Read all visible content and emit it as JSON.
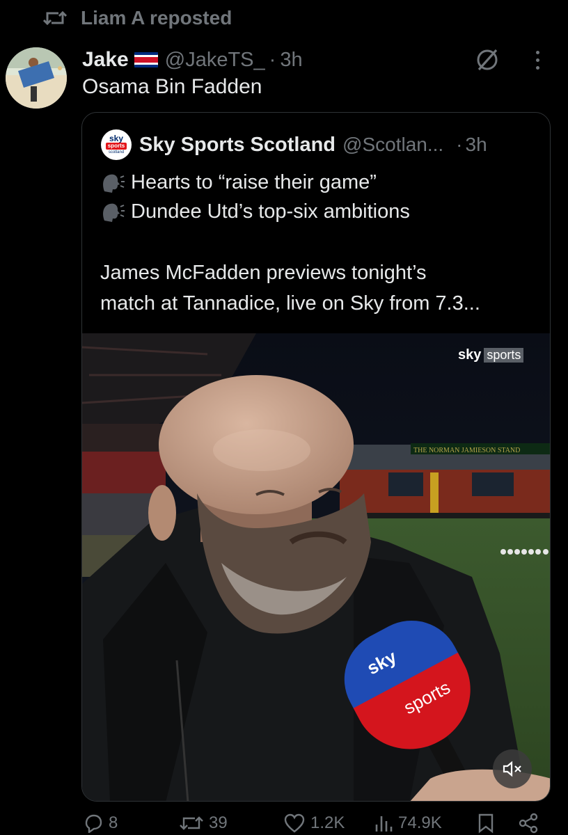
{
  "repost": {
    "icon": "repost-icon",
    "text": "Liam A reposted"
  },
  "tweet": {
    "author_name": "Jake",
    "flag_icon": "costa-rica-flag-icon",
    "handle": "@JakeTS_",
    "separator": "·",
    "time": "3h",
    "text": "Osama Bin Fadden"
  },
  "quote": {
    "logo": {
      "line1": "sky",
      "line2": "sports",
      "line3": "scotland"
    },
    "author_name": "Sky Sports Scotland",
    "handle": "@Scotlan...",
    "separator": "·",
    "time": "3h",
    "line1": "Hearts to “raise their game”",
    "line2": "Dundee Utd’s top-six ambitions",
    "line3": "James McFadden previews tonight’s",
    "line4": "match at Tannadice, live on Sky from 7.3...",
    "video": {
      "watermark_sky": "sky",
      "watermark_sports": "sports",
      "stand_sign": "THE NORMAN JAMIESON STAND",
      "mic_top": "sky",
      "mic_side": "sky",
      "mic_red": "sports",
      "mic_red2": "sports",
      "mute_icon": "mute-icon"
    }
  },
  "actions": {
    "replies": "8",
    "reposts": "39",
    "likes": "1.2K",
    "views": "74.9K"
  }
}
